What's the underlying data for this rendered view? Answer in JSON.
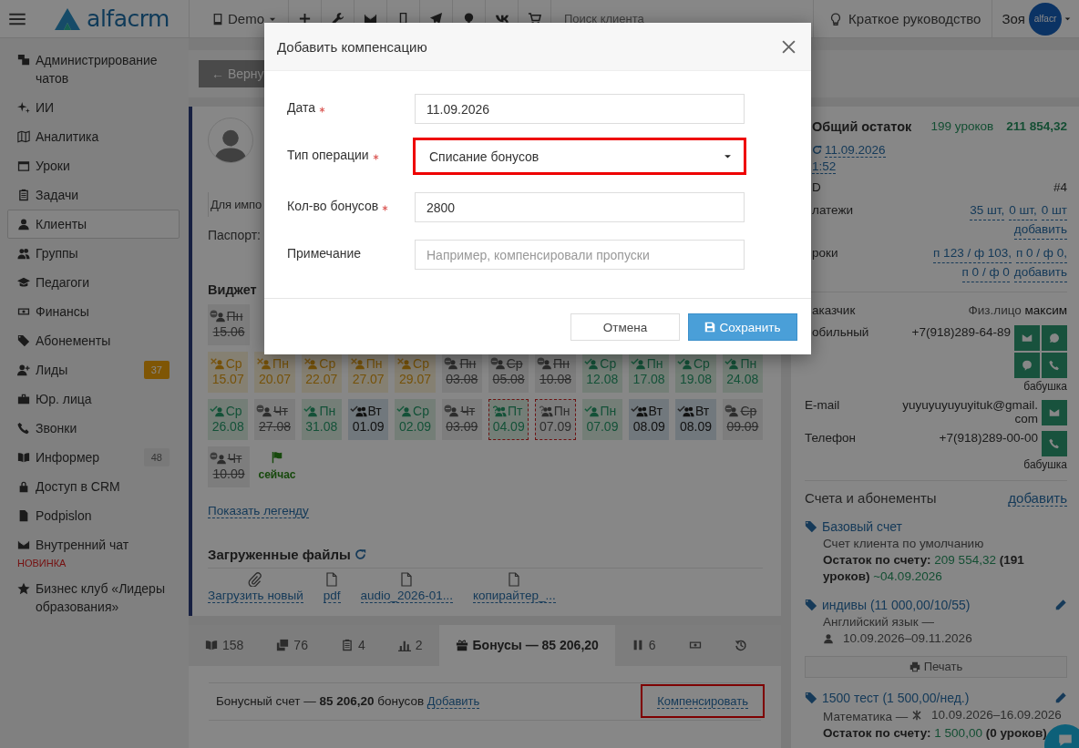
{
  "topbar": {
    "logo": "alfacrm",
    "workspace": "Demo",
    "search": {
      "placeholder": "Поиск клиента"
    },
    "guide": "Краткое руководство",
    "user": "Зоя",
    "avatar_text": "alfacr"
  },
  "sidebar": {
    "items": [
      {
        "label": "Администрирование чатов",
        "selected": false
      },
      {
        "label": "ИИ",
        "selected": false
      },
      {
        "label": "Аналитика",
        "selected": false
      },
      {
        "label": "Уроки",
        "selected": false
      },
      {
        "label": "Задачи",
        "selected": false
      },
      {
        "label": "Клиенты",
        "selected": true
      },
      {
        "label": "Группы",
        "selected": false
      },
      {
        "label": "Педагоги",
        "selected": false
      },
      {
        "label": "Финансы",
        "selected": false
      },
      {
        "label": "Абонементы",
        "selected": false
      },
      {
        "label": "Лиды",
        "selected": false,
        "badge": {
          "text": "37",
          "kind": "warning"
        }
      },
      {
        "label": "Юр. лица",
        "selected": false
      },
      {
        "label": "Звонки",
        "selected": false
      },
      {
        "label": "Информер",
        "selected": false,
        "badge": {
          "text": "48",
          "kind": "neutral"
        }
      },
      {
        "label": "Доступ в CRM",
        "selected": false
      },
      {
        "label": "Podpislon",
        "selected": false
      },
      {
        "label": "Внутренний чат",
        "selected": false,
        "note": "НОВИНКА"
      },
      {
        "label": "Бизнес клуб «Лидеры образования»",
        "selected": false
      }
    ]
  },
  "card": {
    "back_button": "← Верну",
    "for_import": "Для импо",
    "passport": "Паспорт:",
    "widget": {
      "title": "Виджет",
      "rows": [
        [
          {
            "weekday": "Пн",
            "date": "15.06",
            "kind": "cancelled",
            "group": false
          }
        ],
        [
          {
            "weekday": "Ср",
            "date": "15.07",
            "kind": "planned",
            "group": false
          },
          {
            "weekday": "Пн",
            "date": "20.07",
            "kind": "planned",
            "group": false
          },
          {
            "weekday": "Ср",
            "date": "22.07",
            "kind": "planned",
            "group": false
          },
          {
            "weekday": "Пн",
            "date": "27.07",
            "kind": "planned",
            "group": false
          },
          {
            "weekday": "Ср",
            "date": "29.07",
            "kind": "planned",
            "group": false
          },
          {
            "weekday": "Пн",
            "date": "03.08",
            "kind": "cancelled",
            "group": false
          },
          {
            "weekday": "Ср",
            "date": "05.08",
            "kind": "cancelled",
            "group": false
          },
          {
            "weekday": "Пн",
            "date": "10.08",
            "kind": "cancelled",
            "group": false
          },
          {
            "weekday": "Ср",
            "date": "12.08",
            "kind": "attended",
            "group": false
          },
          {
            "weekday": "Пн",
            "date": "17.08",
            "kind": "attended",
            "group": false
          },
          {
            "weekday": "Ср",
            "date": "19.08",
            "kind": "attended",
            "group": false
          },
          {
            "weekday": "Пн",
            "date": "24.08",
            "kind": "attended",
            "group": false
          }
        ],
        [
          {
            "weekday": "Ср",
            "date": "26.08",
            "kind": "attended",
            "group": false
          },
          {
            "weekday": "Чт",
            "date": "27.08",
            "kind": "cancelled",
            "group": false
          },
          {
            "weekday": "Пн",
            "date": "31.08",
            "kind": "attended",
            "group": false
          },
          {
            "weekday": "Вт",
            "date": "01.09",
            "kind": "group",
            "group": true
          },
          {
            "weekday": "Ср",
            "date": "02.09",
            "kind": "attended",
            "group": false
          },
          {
            "weekday": "Чт",
            "date": "03.09",
            "kind": "cancelled",
            "group": false
          },
          {
            "weekday": "Пт",
            "date": "04.09",
            "kind": "tentative",
            "group": true
          },
          {
            "weekday": "Пн",
            "date": "07.09",
            "kind": "unconfirmed",
            "group": true
          },
          {
            "weekday": "Пн",
            "date": "07.09",
            "kind": "attended",
            "group": false
          },
          {
            "weekday": "Вт",
            "date": "08.09",
            "kind": "group",
            "group": true
          },
          {
            "weekday": "Вт",
            "date": "08.09",
            "kind": "group",
            "group": true
          },
          {
            "weekday": "Ср",
            "date": "09.09",
            "kind": "cancelled",
            "group": false
          }
        ],
        [
          {
            "weekday": "Чт",
            "date": "10.09",
            "kind": "cancelled",
            "group": false
          }
        ]
      ],
      "now": "сейчас",
      "legend_link": "Показать легенду"
    },
    "files": {
      "title": "Загруженные файлы",
      "items": [
        {
          "label": "Загрузить новый",
          "kind": "upload"
        },
        {
          "label": "pdf",
          "kind": "file"
        },
        {
          "label": "audio_2026-01...",
          "kind": "file"
        },
        {
          "label": "копирайтер_...",
          "kind": "file"
        }
      ]
    }
  },
  "tabs": [
    {
      "label": "158",
      "selected": false
    },
    {
      "label": "76",
      "selected": false
    },
    {
      "label": "4",
      "selected": false
    },
    {
      "label": "2",
      "selected": false
    },
    {
      "label": "Бонусы — 85 206,20",
      "selected": true
    },
    {
      "label": "6",
      "selected": false
    },
    {
      "selected": false
    },
    {
      "selected": false
    }
  ],
  "bonus": {
    "text": "Бонусный счет — **85 206,20** бонусов",
    "add_link": "Добавить",
    "compensate_link": "Компенсировать",
    "compensate_highlighted": true
  },
  "summary": {
    "title": "Общий остаток",
    "lessons": "199 уроков",
    "amount": "211 854,32",
    "updated_date": "11.09.2026",
    "updated_time": "1:52",
    "rows": [
      {
        "label": "D",
        "value": "#4"
      },
      {
        "label": "латежи",
        "links": [
          "35 шт,",
          "0 шт,",
          "0 шт"
        ],
        "add": "добавить"
      },
      {
        "label": "роки",
        "links": [
          "п 123 / ф 103,",
          "п 0 / ф 0,",
          "п 0 / ф 0"
        ],
        "add": "добавить"
      }
    ],
    "customer": {
      "label": "аказчик",
      "value": "Физ.лицо",
      "name": "максим"
    },
    "contacts": [
      {
        "label": "обильный",
        "value": "+7(918)289-64-89",
        "kind": "mobile",
        "note": "бабушка"
      },
      {
        "label": "E-mail",
        "value": "yuyuyuyuyuyituk@gmail.com",
        "kind": "email"
      },
      {
        "label": "Телефон",
        "value": "+7(918)289-00-00",
        "kind": "phone",
        "note": "бабушка"
      }
    ],
    "accounts_title": "Счета и абонементы",
    "accounts_add": "добавить",
    "accounts": [
      {
        "title": "Базовый счет",
        "editable": false,
        "subtitle": "Счет клиента по умолчанию",
        "balance": {
          "label": "Остаток по счету:",
          "amount": "209 554,32",
          "lessons": "(191 уроков)",
          "forecast": "~04.09.2026"
        }
      },
      {
        "title": "индивы (11 000,00/10/55)",
        "editable": true,
        "subject": "Английский язык —",
        "period": "10.09.2026–09.11.2026",
        "print": "Печать"
      },
      {
        "title": "1500 тест (1 500,00/нед.)",
        "editable": true,
        "subject": "Математика —",
        "period": "10.09.2026–16.09.2026",
        "balance": {
          "label": "Остаток по счету:",
          "amount": "1 500,00",
          "lessons": "(0 уроков)"
        }
      }
    ]
  },
  "dialog": {
    "title": "Добавить компенсацию",
    "fields": [
      {
        "label": "Дата",
        "required": true,
        "kind": "text",
        "value": "11.09.2026",
        "highlighted": false
      },
      {
        "label": "Тип операции",
        "required": true,
        "kind": "select",
        "value": "Списание бонусов",
        "highlighted": true
      },
      {
        "label": "Кол-во бонусов",
        "required": true,
        "kind": "text",
        "value": "2800",
        "highlighted": false
      },
      {
        "label": "Примечание",
        "required": false,
        "kind": "text",
        "placeholder": "Например, компенсировали пропуски",
        "highlighted": false
      }
    ],
    "cancel": "Отмена",
    "save": "Сохранить"
  }
}
